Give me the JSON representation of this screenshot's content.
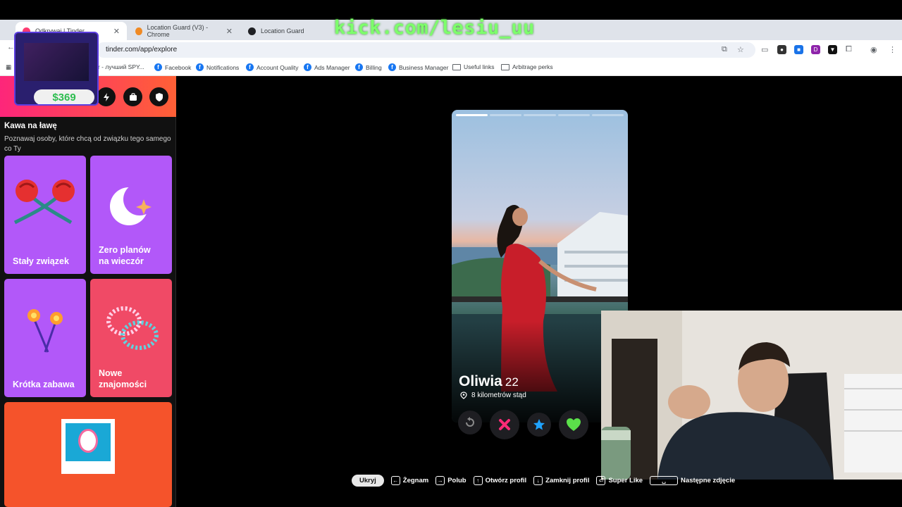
{
  "stream": {
    "overlay_text": "kick.com/lesiu_uu"
  },
  "browser": {
    "tabs": [
      {
        "title": "Odkrywaj | Tinder",
        "active": true
      },
      {
        "title": "Location Guard (V3) - Chrome",
        "active": false
      },
      {
        "title": "Location Guard",
        "active": false
      }
    ],
    "url": "tinder.com/app/explore",
    "bookmarks": [
      {
        "label": "ver - лучший SPY...",
        "icon": "spy-icon"
      },
      {
        "label": "Facebook",
        "icon": "facebook-icon"
      },
      {
        "label": "Notifications",
        "icon": "facebook-icon"
      },
      {
        "label": "Account Quality",
        "icon": "facebook-icon"
      },
      {
        "label": "Ads Manager",
        "icon": "facebook-icon"
      },
      {
        "label": "Billing",
        "icon": "facebook-icon"
      },
      {
        "label": "Business Manager",
        "icon": "facebook-icon"
      },
      {
        "label": "Useful links",
        "icon": "folder-icon"
      },
      {
        "label": "Arbitrage perks",
        "icon": "folder-icon"
      }
    ]
  },
  "promo": {
    "price": "$369"
  },
  "sidebar": {
    "section_title": "Kawa na ławę",
    "section_subtitle": "Poznawaj osoby, które chcą od związku tego samego co Ty",
    "cards": [
      {
        "label": "Stały związek",
        "color": "#b258f9"
      },
      {
        "label": "Zero planów na wieczór",
        "color": "#b258f9"
      },
      {
        "label": "Krótka zabawa",
        "color": "#b258f9"
      },
      {
        "label": "Nowe znajomości",
        "color": "#f04a66"
      },
      {
        "label": "",
        "color": "#f5532b"
      }
    ]
  },
  "profile": {
    "name": "Oliwia",
    "age": "22",
    "distance": "8 kilometrów stąd",
    "photo_count": 5,
    "current_photo": 1
  },
  "actions": [
    {
      "name": "rewind-button",
      "icon": "rewind-icon",
      "color": "#8a8a8a"
    },
    {
      "name": "nope-button",
      "icon": "x-icon",
      "color": "#ff2b77"
    },
    {
      "name": "super-like-button",
      "icon": "star-icon",
      "color": "#1fa3ff"
    },
    {
      "name": "like-button",
      "icon": "heart-icon",
      "color": "#5be04a"
    }
  ],
  "hints": {
    "hide": "Ukryj",
    "items": [
      {
        "key": "←",
        "label": "Żegnam"
      },
      {
        "key": "→",
        "label": "Polub"
      },
      {
        "key": "↑",
        "label": "Otwórz profil"
      },
      {
        "key": "↓",
        "label": "Zamknij profil"
      },
      {
        "key": "⏎",
        "label": "Super Like"
      },
      {
        "key": "␣",
        "label": "Następne zdjęcie"
      }
    ]
  }
}
